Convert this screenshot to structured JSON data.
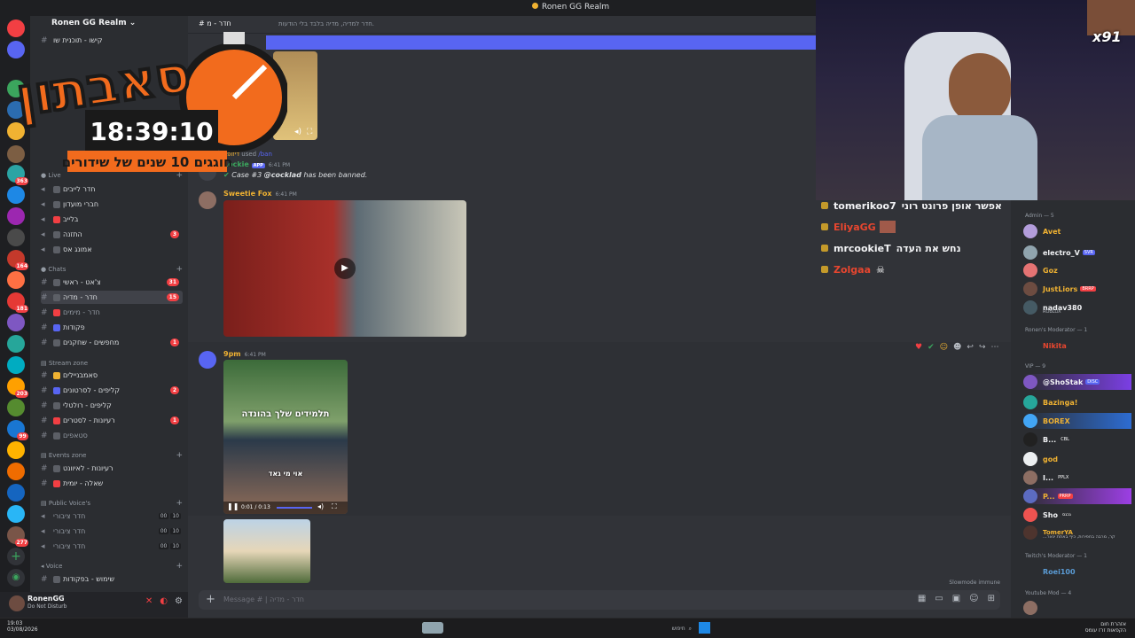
{
  "window": {
    "title": "Ronen GG Realm"
  },
  "server": {
    "name": "Ronen GG Realm"
  },
  "overlay": {
    "logo_title": "סאבתון",
    "timer": "18:39:10",
    "subtitle": "חוגגים 10 שנים של שידורים",
    "cam_badge": "x91"
  },
  "sidebar": {
    "top_channel": "קישו - תוכנית שו",
    "categories": [
      {
        "label": "Live",
        "channels": [
          {
            "label": "חדר לייבים",
            "badge": ""
          },
          {
            "label": "חברי מועדון",
            "badge": ""
          },
          {
            "label": "בלייב",
            "badge": ""
          },
          {
            "label": "התזנה",
            "badge": "3"
          },
          {
            "label": "אמונג אס",
            "badge": ""
          }
        ]
      },
      {
        "label": "Chats",
        "channels": [
          {
            "label": "צ'אט - ראשי",
            "badge": "31"
          },
          {
            "label": "חדר - מדיה",
            "badge": "15",
            "active": true
          },
          {
            "label": "חדר - מימים",
            "badge": ""
          },
          {
            "label": "פקודות",
            "badge": ""
          },
          {
            "label": "מחפשים - שחקנים",
            "badge": "1"
          }
        ]
      },
      {
        "label": "Stream zone",
        "channels": [
          {
            "label": "סאמבניילים",
            "badge": ""
          },
          {
            "label": "קליפים - לסרטונים",
            "badge": "2"
          },
          {
            "label": "קליפים - רולטלי",
            "badge": ""
          },
          {
            "label": "רעיונות - לסטרים",
            "badge": "1"
          },
          {
            "label": "סטאפים",
            "badge": ""
          }
        ]
      },
      {
        "label": "Events zone",
        "channels": [
          {
            "label": "רעיונות - לאיוונט",
            "badge": ""
          },
          {
            "label": "שאלה - יומית",
            "badge": ""
          }
        ]
      },
      {
        "label": "Public Voice's",
        "channels": [
          {
            "label": "חדר ציבורי",
            "count": "00",
            "limit": "10"
          },
          {
            "label": "חדר ציבורי",
            "count": "00",
            "limit": "10"
          },
          {
            "label": "חדר ציבורי",
            "count": "00",
            "limit": "10"
          }
        ]
      },
      {
        "label": "Voice",
        "channels": [
          {
            "label": "שימוש - בפקודות",
            "badge": ""
          }
        ]
      }
    ]
  },
  "user": {
    "name": "RonenGG",
    "status": "Do Not Disturb"
  },
  "channel": {
    "name": "חדר - מ",
    "topic": "חדר למדיה, מדיה בלבד בלי הודעות."
  },
  "messages": [
    {
      "author": "דיזופר",
      "action": "used",
      "command": "/ban"
    },
    {
      "author": "Lockie",
      "tag": "APP",
      "time": "6:41 PM",
      "text_prefix": "Case #3",
      "mention": "@cocklad",
      "text": "has been banned."
    },
    {
      "author": "Sweetie Fox",
      "time": "6:41 PM"
    },
    {
      "author": "9pm",
      "time": "6:41 PM",
      "video_caption_top": "תלמידים שלך בהונדה",
      "video_caption_mid": "אוי מי גאד",
      "video_time": "0:01 / 0:13"
    }
  ],
  "composer": {
    "placeholder": "Message # | חדר - מדיה",
    "slowmode": "Slowmode immune"
  },
  "twitch_chat": [
    {
      "user": "tomerikoo7",
      "msg": "אפשר אופן פרונט רוני",
      "color": "#f2f3f5"
    },
    {
      "user": "EliyaGG",
      "msg": "",
      "color": "#e8462f"
    },
    {
      "user": "mrcookieT",
      "msg": "נחש את העדה",
      "color": "#f2f3f5"
    },
    {
      "user": "Zolgaa",
      "msg": "",
      "color": "#e8462f"
    }
  ],
  "members": {
    "groups": [
      {
        "label": "Admin — 5",
        "members": [
          {
            "name": "Avet",
            "color": "#f0b232"
          },
          {
            "name": "electro_V",
            "tag": "SVR",
            "color": "#f2f3f5"
          },
          {
            "name": "Goz",
            "color": "#f0b232"
          },
          {
            "name": "JustLiors",
            "tag": "BRRP",
            "color": "#f0b232"
          },
          {
            "name": "nadav380",
            "sub": "ROBLOX",
            "color": "#f2f3f5"
          }
        ]
      },
      {
        "label": "Ronen's Moderator — 1",
        "members": [
          {
            "name": "Nikita",
            "color": "#e8462f"
          }
        ]
      },
      {
        "label": "VIP — 9",
        "members": [
          {
            "name": "@ShoStak",
            "tag": "DISC",
            "color": "#f2f3f5"
          },
          {
            "name": "Bazinga!",
            "color": "#f0b232"
          },
          {
            "name": "BOREX",
            "color": "#f0b232"
          },
          {
            "name": "B...",
            "tag": "CBL",
            "color": "#f2f3f5"
          },
          {
            "name": "god",
            "color": "#f0b232"
          },
          {
            "name": "I...",
            "tag": "PPLX",
            "color": "#f2f3f5"
          },
          {
            "name": "P...",
            "tag": "PRRP",
            "color": "#f0b232"
          },
          {
            "name": "Sho",
            "tag": "נכנס",
            "color": "#f2f3f5"
          },
          {
            "name": "TomerYA",
            "sub": "...קר, מרבה בחפירות, כיף באתת ינאר",
            "color": "#f0b232"
          }
        ]
      },
      {
        "label": "Twitch's Moderator — 1",
        "members": [
          {
            "name": "Roei100",
            "color": "#5a9bd5"
          }
        ]
      },
      {
        "label": "Youtube Mod — 4",
        "members": []
      }
    ]
  },
  "taskbar": {
    "time": "19:03",
    "date": "03/08/2026",
    "search_placeholder": "חיפוש",
    "tray_line1": "אזהרת חום",
    "tray_line2": "הקפאות זרז עומס"
  },
  "colors": {
    "discord_blurple": "#5865f2",
    "mention_red": "#f23f43",
    "admin_gold": "#f0b232"
  }
}
